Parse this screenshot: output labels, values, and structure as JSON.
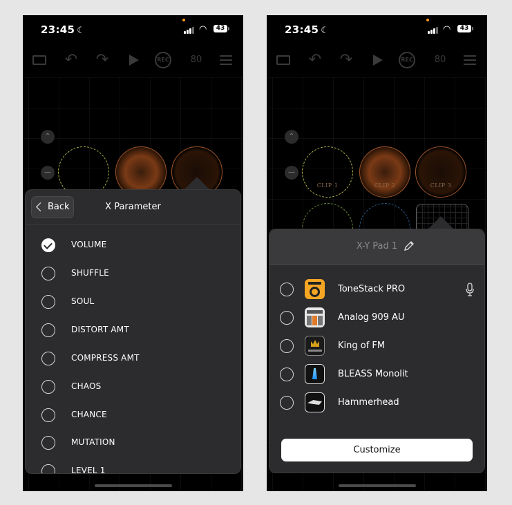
{
  "status": {
    "time": "23:45",
    "battery": "43"
  },
  "toolbar": {
    "tempo": "80",
    "rec_label": "REC"
  },
  "pads": {
    "clip_labels": [
      "CLIP 1",
      "CLIP 2",
      "CLIP 3"
    ]
  },
  "colors": {
    "accent": "#ff9b1a",
    "panel": "#2c2c2e",
    "pad_border": "#a0552a"
  },
  "left_panel": {
    "back_label": "Back",
    "title": "X Parameter",
    "params": [
      {
        "label": "VOLUME",
        "selected": true
      },
      {
        "label": "SHUFFLE",
        "selected": false
      },
      {
        "label": "SOUL",
        "selected": false
      },
      {
        "label": "DISTORT AMT",
        "selected": false
      },
      {
        "label": "COMPRESS AMT",
        "selected": false
      },
      {
        "label": "CHAOS",
        "selected": false
      },
      {
        "label": "CHANCE",
        "selected": false
      },
      {
        "label": "MUTATION",
        "selected": false
      },
      {
        "label": "LEVEL 1",
        "selected": false
      }
    ]
  },
  "right_panel": {
    "title": "X-Y Pad 1",
    "plugins": [
      {
        "label": "ToneStack PRO",
        "icon": "tonestack-icon",
        "mic": true
      },
      {
        "label": "Analog 909 AU",
        "icon": "analog909-icon",
        "mic": false
      },
      {
        "label": "King of FM",
        "icon": "kingfm-icon",
        "mic": false
      },
      {
        "label": "BLEASS Monolit",
        "icon": "monolit-icon",
        "mic": false
      },
      {
        "label": "Hammerhead",
        "icon": "hammerhead-icon",
        "mic": false
      }
    ],
    "customize_label": "Customize"
  }
}
